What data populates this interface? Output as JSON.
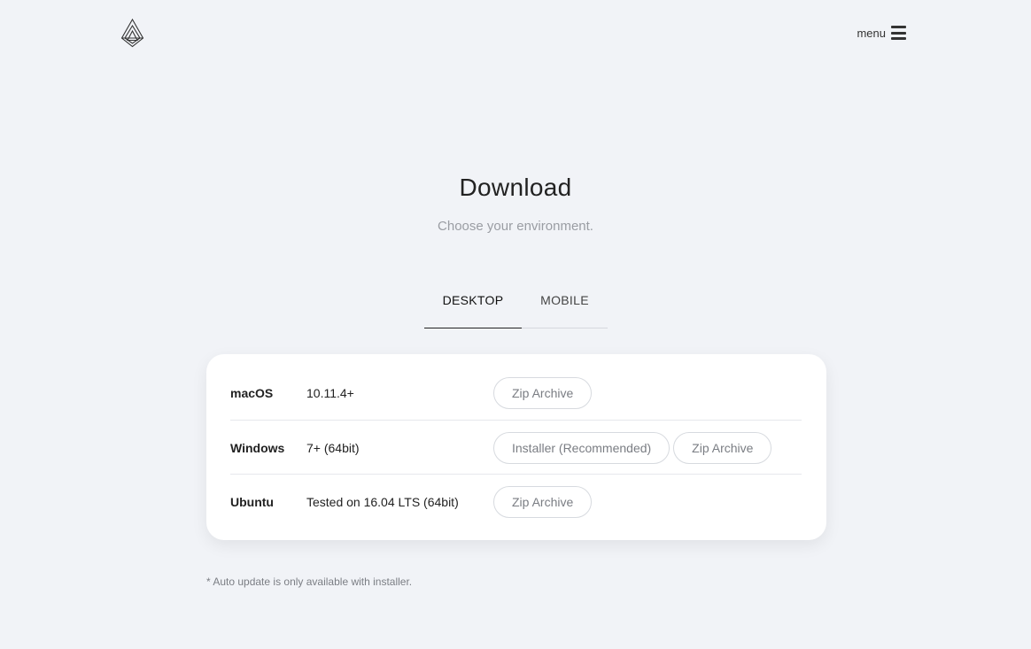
{
  "header": {
    "logo_icon": "geometric-triangle-logo",
    "menu_label": "menu",
    "menu_icon": "hamburger-icon"
  },
  "main": {
    "title": "Download",
    "subtitle": "Choose your environment."
  },
  "tabs": [
    {
      "label": "DESKTOP",
      "active": true
    },
    {
      "label": "MOBILE",
      "active": false
    }
  ],
  "downloads": [
    {
      "os": "macOS",
      "version": "10.11.4+",
      "buttons": [
        "Zip Archive"
      ]
    },
    {
      "os": "Windows",
      "version": "7+ (64bit)",
      "buttons": [
        "Installer (Recommended)",
        "Zip Archive"
      ]
    },
    {
      "os": "Ubuntu",
      "version": "Tested on 16.04 LTS (64bit)",
      "buttons": [
        "Zip Archive"
      ]
    }
  ],
  "footnote": "* Auto update is only available with installer.",
  "colors": {
    "background": "#f1f3f7",
    "card": "#ffffff",
    "text": "#222222",
    "muted": "#9a9da3",
    "button_border": "#d7dadf"
  }
}
